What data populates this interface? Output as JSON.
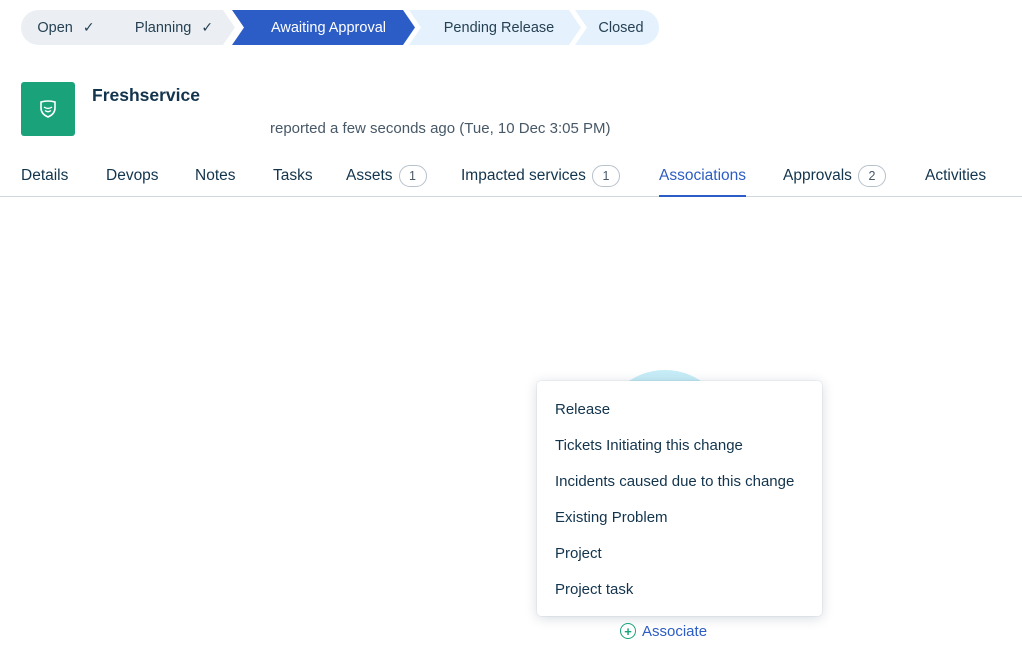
{
  "stepper": {
    "steps": [
      {
        "label": "Open",
        "done": true
      },
      {
        "label": "Planning",
        "done": true
      },
      {
        "label": "Awaiting Approval",
        "done": false
      },
      {
        "label": "Pending Release",
        "done": false
      },
      {
        "label": "Closed",
        "done": false
      }
    ],
    "check_glyph": "✓",
    "active_step": "Awaiting Approval",
    "active_color": "#2c5cc5"
  },
  "header": {
    "app_name": "Freshservice",
    "logo_icon": "shield-icon",
    "logo_color": "#1aa37a",
    "reported_text": "reported a few seconds ago (Tue, 10 Dec 3:05 PM)"
  },
  "tabs": [
    {
      "label": "Details"
    },
    {
      "label": "Devops"
    },
    {
      "label": "Notes"
    },
    {
      "label": "Tasks"
    },
    {
      "label": "Assets",
      "count": "1"
    },
    {
      "label": "Impacted services",
      "count": "1"
    },
    {
      "label": "Associations"
    },
    {
      "label": "Approvals",
      "count": "2"
    },
    {
      "label": "Activities"
    }
  ],
  "active_tab": "Associations",
  "menu": {
    "items": [
      "Release",
      "Tickets Initiating this change",
      "Incidents caused due to this change",
      "Existing Problem",
      "Project",
      "Project task"
    ]
  },
  "associate": {
    "label": "Associate",
    "icon": "plus-circle-icon"
  }
}
